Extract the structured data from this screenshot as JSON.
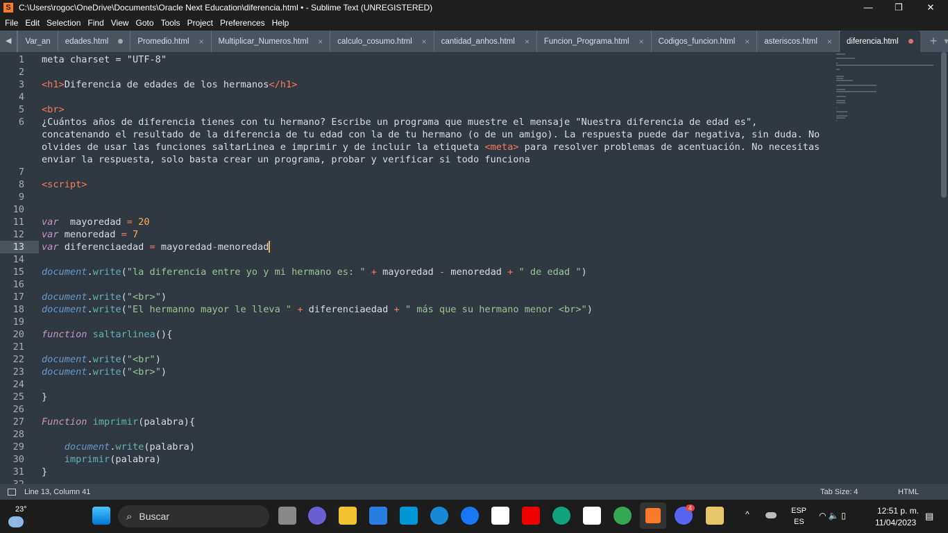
{
  "window": {
    "title": "C:\\Users\\rogoc\\OneDrive\\Documents\\Oracle Next Education\\diferencia.html • - Sublime Text (UNREGISTERED)",
    "minimize": "—",
    "maximize": "❐",
    "close": "✕"
  },
  "menu": [
    "File",
    "Edit",
    "Selection",
    "Find",
    "View",
    "Goto",
    "Tools",
    "Project",
    "Preferences",
    "Help"
  ],
  "tabs": [
    {
      "label": "Var_an",
      "state": "none"
    },
    {
      "label": "edades.html",
      "state": "dirty"
    },
    {
      "label": "Promedio.html",
      "state": "close"
    },
    {
      "label": "Multiplicar_Numeros.html",
      "state": "close"
    },
    {
      "label": "calculo_cosumo.html",
      "state": "close"
    },
    {
      "label": "cantidad_anhos.html",
      "state": "close"
    },
    {
      "label": "Funcion_Programa.html",
      "state": "close"
    },
    {
      "label": "Codigos_funcion.html",
      "state": "close"
    },
    {
      "label": "asteriscos.html",
      "state": "close"
    },
    {
      "label": "diferencia.html",
      "state": "active-dirty"
    }
  ],
  "tab_close_glyph": "×",
  "tab_nav": {
    "back": "◀",
    "forward": "▶",
    "new_tab": "+",
    "dropdown": "▼"
  },
  "editor": {
    "current_line": 13,
    "lines": [
      [
        [
          "pl",
          "meta charset = \"UTF-8\""
        ]
      ],
      [],
      [
        [
          "tag",
          "<h1>"
        ],
        [
          "pl",
          "Diferencia de edades de los hermanos"
        ],
        [
          "tag",
          "</h1>"
        ]
      ],
      [],
      [
        [
          "tag",
          "<br>"
        ]
      ],
      [
        [
          "pl",
          "¿Cuántos años de diferencia tienes con tu hermano? Escribe un programa que muestre el mensaje \"Nuestra diferencia de edad es\", concatenando el resultado de la diferencia de tu edad con la de tu hermano (o de un amigo). La respuesta puede dar negativa, sin duda. No olvides de usar las funciones saltarLinea e imprimir y de incluir la etiqueta "
        ],
        [
          "tag",
          "<meta>"
        ],
        [
          "pl",
          " para resolver problemas de acentuación. No necesitas enviar la respuesta, solo basta crear un programa, probar y verificar si todo funciona"
        ]
      ],
      [],
      [
        [
          "tag",
          "<script>"
        ]
      ],
      [],
      [],
      [
        [
          "kw",
          "var"
        ],
        [
          "pl",
          "  mayoredad "
        ],
        [
          "op",
          "="
        ],
        [
          "pl",
          " "
        ],
        [
          "num",
          "20"
        ]
      ],
      [
        [
          "kw",
          "var"
        ],
        [
          "pl",
          " menoredad "
        ],
        [
          "op",
          "="
        ],
        [
          "pl",
          " "
        ],
        [
          "num",
          "7"
        ]
      ],
      [
        [
          "kw",
          "var"
        ],
        [
          "pl",
          " diferenciaedad "
        ],
        [
          "op",
          "="
        ],
        [
          "pl",
          " mayoredad"
        ],
        [
          "op",
          "-"
        ],
        [
          "pl",
          "menoredad"
        ]
      ],
      [],
      [
        [
          "lang",
          "document"
        ],
        [
          "pl",
          "."
        ],
        [
          "fn",
          "write"
        ],
        [
          "pl",
          "("
        ],
        [
          "str",
          "\"la diferencia entre yo y mi hermano es: \""
        ],
        [
          "pl",
          " "
        ],
        [
          "op",
          "+"
        ],
        [
          "pl",
          " mayoredad "
        ],
        [
          "op",
          "-"
        ],
        [
          "pl",
          " menoredad "
        ],
        [
          "op",
          "+"
        ],
        [
          "pl",
          " "
        ],
        [
          "str",
          "\" de edad \""
        ],
        [
          "pl",
          ")"
        ]
      ],
      [],
      [
        [
          "lang",
          "document"
        ],
        [
          "pl",
          "."
        ],
        [
          "fn",
          "write"
        ],
        [
          "pl",
          "("
        ],
        [
          "str",
          "\"<br>\""
        ],
        [
          "pl",
          ")"
        ]
      ],
      [
        [
          "lang",
          "document"
        ],
        [
          "pl",
          "."
        ],
        [
          "fn",
          "write"
        ],
        [
          "pl",
          "("
        ],
        [
          "str",
          "\"El hermanno mayor le lleva \""
        ],
        [
          "pl",
          " "
        ],
        [
          "op",
          "+"
        ],
        [
          "pl",
          " diferenciaedad "
        ],
        [
          "op",
          "+"
        ],
        [
          "pl",
          " "
        ],
        [
          "str",
          "\" más que su hermano menor <br>\""
        ],
        [
          "pl",
          ")"
        ]
      ],
      [],
      [
        [
          "kw",
          "function"
        ],
        [
          "pl",
          " "
        ],
        [
          "fn",
          "saltarlinea"
        ],
        [
          "pl",
          "(){"
        ]
      ],
      [],
      [
        [
          "lang",
          "document"
        ],
        [
          "pl",
          "."
        ],
        [
          "fn",
          "write"
        ],
        [
          "pl",
          "("
        ],
        [
          "str",
          "\"<br\""
        ],
        [
          "pl",
          ")"
        ]
      ],
      [
        [
          "lang",
          "document"
        ],
        [
          "pl",
          "."
        ],
        [
          "fn",
          "write"
        ],
        [
          "pl",
          "("
        ],
        [
          "str",
          "\"<br>\""
        ],
        [
          "pl",
          ")"
        ]
      ],
      [],
      [
        [
          "pl",
          "}"
        ]
      ],
      [],
      [
        [
          "kw",
          "Function"
        ],
        [
          "pl",
          " "
        ],
        [
          "fn",
          "imprimir"
        ],
        [
          "pl",
          "(palabra){"
        ]
      ],
      [],
      [
        [
          "pl",
          "    "
        ],
        [
          "lang",
          "document"
        ],
        [
          "pl",
          "."
        ],
        [
          "fn",
          "write"
        ],
        [
          "pl",
          "(palabra)"
        ]
      ],
      [
        [
          "pl",
          "    "
        ],
        [
          "fn",
          "imprimir"
        ],
        [
          "pl",
          "(palabra)"
        ]
      ],
      [
        [
          "pl",
          "}"
        ]
      ],
      []
    ]
  },
  "status": {
    "position": "Line 13, Column 41",
    "tab_size": "Tab Size: 4",
    "syntax": "HTML"
  },
  "taskbar": {
    "weather": "23°",
    "search": "Buscar",
    "lang1": "ESP",
    "lang2": "ES",
    "time": "12:51 p. m.",
    "date": "11/04/2023",
    "discord_badge": "4",
    "tray_chevron": "^"
  },
  "colors": {
    "background": "#303841",
    "keyword": "#c695c6",
    "string": "#99c794",
    "operator": "#f97b58",
    "number": "#f9ae58",
    "function": "#5fb4b4",
    "language": "#6699cc"
  }
}
